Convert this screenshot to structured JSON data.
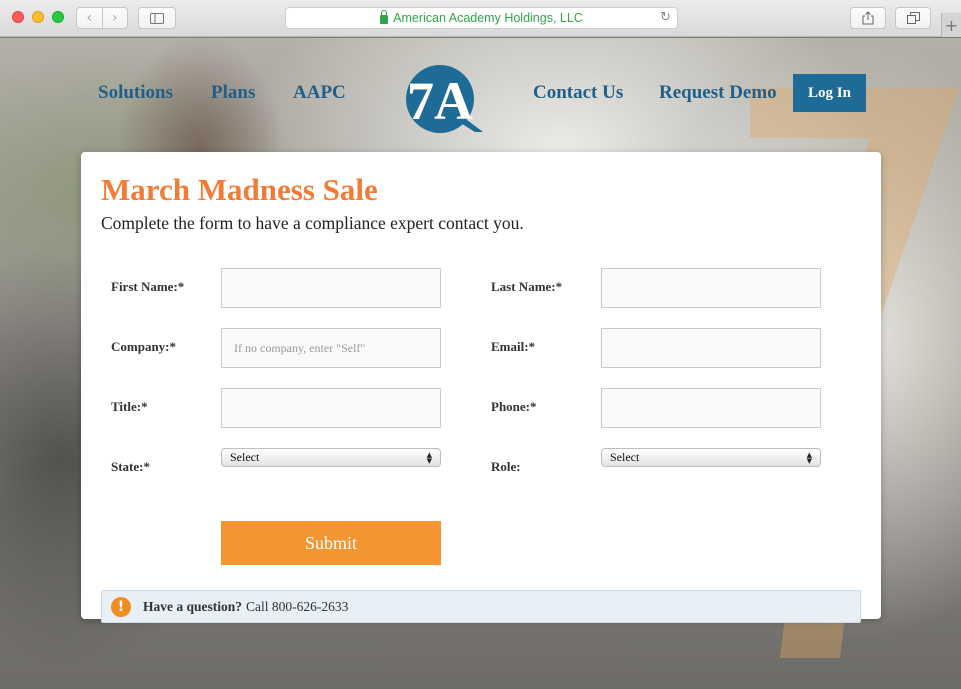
{
  "browser": {
    "address": "American Academy Holdings, LLC",
    "icons": {
      "back": "chevron-left-icon",
      "forward": "chevron-right-icon",
      "sidebar": "sidebar-icon",
      "lock": "lock-icon",
      "reload": "reload-icon",
      "share": "share-icon",
      "tabs": "tabs-icon",
      "new_tab": "plus-icon"
    }
  },
  "nav": {
    "items": [
      "Solutions",
      "Plans",
      "AAPC",
      "Contact Us",
      "Request Demo"
    ],
    "login": "Log In",
    "logo_text": "7A"
  },
  "form": {
    "title": "March Madness Sale",
    "subtitle": "Complete the form to have a compliance expert contact you.",
    "fields": {
      "first_name": {
        "label": "First Name:*",
        "value": ""
      },
      "last_name": {
        "label": "Last Name:*",
        "value": ""
      },
      "company": {
        "label": "Company:*",
        "placeholder": "If no company, enter \"Self\""
      },
      "email": {
        "label": "Email:*",
        "value": ""
      },
      "title": {
        "label": "Title:*",
        "value": ""
      },
      "phone": {
        "label": "Phone:*",
        "value": ""
      },
      "state": {
        "label": "State:*",
        "selected": "Select"
      },
      "role": {
        "label": "Role:",
        "selected": "Select"
      }
    },
    "submit": "Submit",
    "notice": {
      "bold": "Have a question?",
      "text": "Call 800-626-2633",
      "icon": "exclamation-icon"
    }
  },
  "colors": {
    "brand_blue": "#1d6b96",
    "accent_orange": "#f07c37",
    "submit_orange": "#f39530"
  }
}
